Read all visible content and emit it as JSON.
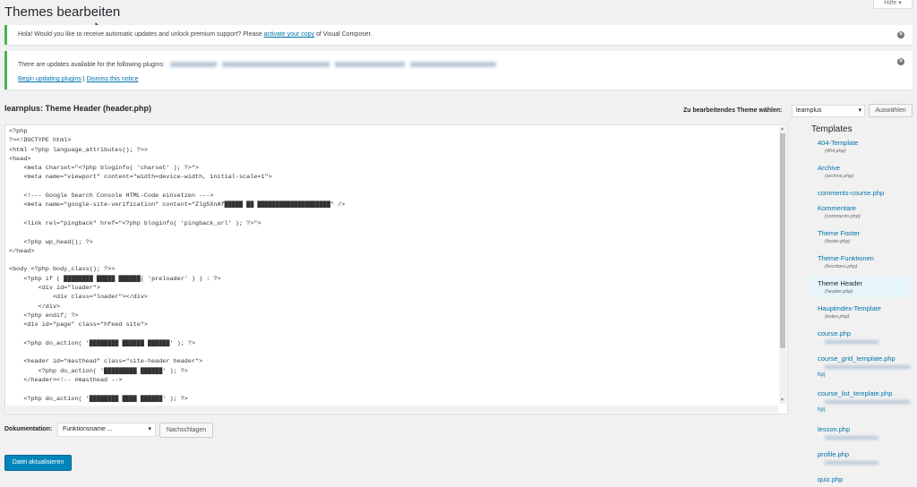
{
  "page": {
    "title": "Themes bearbeiten",
    "help_tab": "Hilfe ▾"
  },
  "notices": {
    "vc": {
      "prefix": "Hola! Would you like to receive automatic updates and unlock premium support? Please ",
      "link": "activate your copy",
      "suffix": " of Visual Composer."
    },
    "updates": {
      "text": "There are updates available for the following plugins:",
      "begin_link": "Begin updating plugins",
      "separator": " | ",
      "dismiss_link": "Dismiss this notice"
    }
  },
  "editor": {
    "file_title": "learnplus: Theme Header (header.php)",
    "theme_select_label": "Zu bearbeitendes Theme wählen:",
    "theme_select_value": "learnplus",
    "choose_button": "Auswählen",
    "code": "<?php\n?><!DOCTYPE html>\n<html <?php language_attributes(); ?>>\n<head>\n    <meta charset=\"<?php bloginfo( 'charset' ); ?>\">\n    <meta name=\"viewport\" content=\"width=device-width, initial-scale=1\">\n\n    <!--- Google Search Console HTML-Code einsetzen --->\n    <meta name=\"google-site-verification\" content=\"Zlg5XnAf█████ ██ ████████████████████\" />\n\n    <link rel=\"pingback\" href=\"<?php bloginfo( 'pingback_url' ); ?>\">\n\n    <?php wp_head(); ?>\n</head>\n\n<body <?php body_class(); ?>>\n    <?php if ( ████████ █████ ██████( 'preloader' ) ) : ?>\n        <div id=\"loader\">\n            <div class=\"loader\"></div>\n        </div>\n    <?php endif; ?>\n    <div id=\"page\" class=\"hfeed site\">\n\n    <?php do_action( '████████ ██████ ██████' ); ?>\n\n    <header id=\"masthead\" class=\"site-header header\">\n        <?php do_action( '█████████ ██████' ); ?>\n    </header><!-- #masthead -->\n\n    <?php do_action( '████████ ████ ██████' ); ?>"
  },
  "documentation": {
    "label": "Dokumentation:",
    "select_value": "Funktionsname ...",
    "lookup_button": "Nachschlagen"
  },
  "update_button": "Datei aktualisieren",
  "sidebar": {
    "title": "Templates",
    "items": [
      {
        "name": "404-Template",
        "file": "(404.php)"
      },
      {
        "name": "Archive",
        "file": "(archive.php)"
      },
      {
        "name": "comments-course.php",
        "file": ""
      },
      {
        "name": "Kommentare",
        "file": "(comments.php)"
      },
      {
        "name": "Theme Footer",
        "file": "(footer.php)"
      },
      {
        "name": "Theme-Funktionen",
        "file": "(functions.php)"
      },
      {
        "name": "Theme Header",
        "file": "(header.php)"
      },
      {
        "name": "Hauptindex-Template",
        "file": "(index.php)"
      },
      {
        "name": "course.php",
        "file": ""
      },
      {
        "name": "course_grid_template.php",
        "file": ""
      },
      {
        "name": "course_list_template.php",
        "file": ""
      },
      {
        "name": "lesson.php",
        "file": ""
      },
      {
        "name": "profile.php",
        "file": ""
      },
      {
        "name": "quiz.php",
        "file": ""
      }
    ]
  },
  "colors": {
    "accent": "#0073aa",
    "button_primary": "#0085ba",
    "notice_border": "#46b450"
  }
}
